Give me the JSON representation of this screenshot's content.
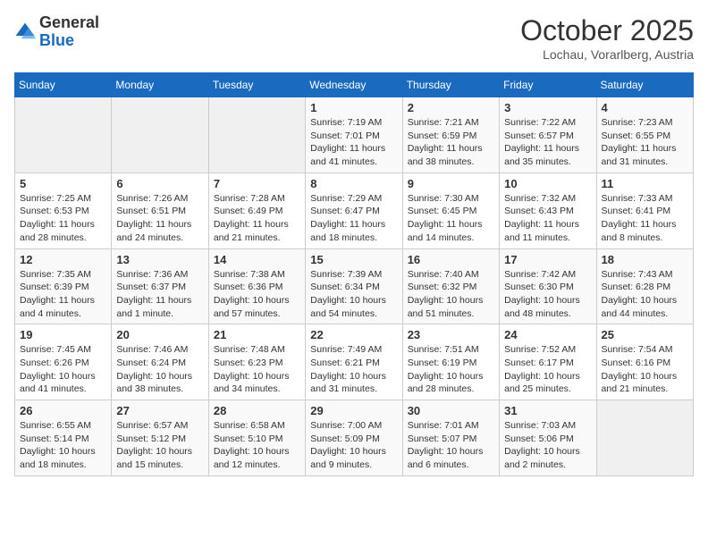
{
  "header": {
    "logo": {
      "general": "General",
      "blue": "Blue"
    },
    "title": "October 2025",
    "location": "Lochau, Vorarlberg, Austria"
  },
  "days_of_week": [
    "Sunday",
    "Monday",
    "Tuesday",
    "Wednesday",
    "Thursday",
    "Friday",
    "Saturday"
  ],
  "weeks": [
    [
      {
        "day": "",
        "info": ""
      },
      {
        "day": "",
        "info": ""
      },
      {
        "day": "",
        "info": ""
      },
      {
        "day": "1",
        "info": "Sunrise: 7:19 AM\nSunset: 7:01 PM\nDaylight: 11 hours and 41 minutes."
      },
      {
        "day": "2",
        "info": "Sunrise: 7:21 AM\nSunset: 6:59 PM\nDaylight: 11 hours and 38 minutes."
      },
      {
        "day": "3",
        "info": "Sunrise: 7:22 AM\nSunset: 6:57 PM\nDaylight: 11 hours and 35 minutes."
      },
      {
        "day": "4",
        "info": "Sunrise: 7:23 AM\nSunset: 6:55 PM\nDaylight: 11 hours and 31 minutes."
      }
    ],
    [
      {
        "day": "5",
        "info": "Sunrise: 7:25 AM\nSunset: 6:53 PM\nDaylight: 11 hours and 28 minutes."
      },
      {
        "day": "6",
        "info": "Sunrise: 7:26 AM\nSunset: 6:51 PM\nDaylight: 11 hours and 24 minutes."
      },
      {
        "day": "7",
        "info": "Sunrise: 7:28 AM\nSunset: 6:49 PM\nDaylight: 11 hours and 21 minutes."
      },
      {
        "day": "8",
        "info": "Sunrise: 7:29 AM\nSunset: 6:47 PM\nDaylight: 11 hours and 18 minutes."
      },
      {
        "day": "9",
        "info": "Sunrise: 7:30 AM\nSunset: 6:45 PM\nDaylight: 11 hours and 14 minutes."
      },
      {
        "day": "10",
        "info": "Sunrise: 7:32 AM\nSunset: 6:43 PM\nDaylight: 11 hours and 11 minutes."
      },
      {
        "day": "11",
        "info": "Sunrise: 7:33 AM\nSunset: 6:41 PM\nDaylight: 11 hours and 8 minutes."
      }
    ],
    [
      {
        "day": "12",
        "info": "Sunrise: 7:35 AM\nSunset: 6:39 PM\nDaylight: 11 hours and 4 minutes."
      },
      {
        "day": "13",
        "info": "Sunrise: 7:36 AM\nSunset: 6:37 PM\nDaylight: 11 hours and 1 minute."
      },
      {
        "day": "14",
        "info": "Sunrise: 7:38 AM\nSunset: 6:36 PM\nDaylight: 10 hours and 57 minutes."
      },
      {
        "day": "15",
        "info": "Sunrise: 7:39 AM\nSunset: 6:34 PM\nDaylight: 10 hours and 54 minutes."
      },
      {
        "day": "16",
        "info": "Sunrise: 7:40 AM\nSunset: 6:32 PM\nDaylight: 10 hours and 51 minutes."
      },
      {
        "day": "17",
        "info": "Sunrise: 7:42 AM\nSunset: 6:30 PM\nDaylight: 10 hours and 48 minutes."
      },
      {
        "day": "18",
        "info": "Sunrise: 7:43 AM\nSunset: 6:28 PM\nDaylight: 10 hours and 44 minutes."
      }
    ],
    [
      {
        "day": "19",
        "info": "Sunrise: 7:45 AM\nSunset: 6:26 PM\nDaylight: 10 hours and 41 minutes."
      },
      {
        "day": "20",
        "info": "Sunrise: 7:46 AM\nSunset: 6:24 PM\nDaylight: 10 hours and 38 minutes."
      },
      {
        "day": "21",
        "info": "Sunrise: 7:48 AM\nSunset: 6:23 PM\nDaylight: 10 hours and 34 minutes."
      },
      {
        "day": "22",
        "info": "Sunrise: 7:49 AM\nSunset: 6:21 PM\nDaylight: 10 hours and 31 minutes."
      },
      {
        "day": "23",
        "info": "Sunrise: 7:51 AM\nSunset: 6:19 PM\nDaylight: 10 hours and 28 minutes."
      },
      {
        "day": "24",
        "info": "Sunrise: 7:52 AM\nSunset: 6:17 PM\nDaylight: 10 hours and 25 minutes."
      },
      {
        "day": "25",
        "info": "Sunrise: 7:54 AM\nSunset: 6:16 PM\nDaylight: 10 hours and 21 minutes."
      }
    ],
    [
      {
        "day": "26",
        "info": "Sunrise: 6:55 AM\nSunset: 5:14 PM\nDaylight: 10 hours and 18 minutes."
      },
      {
        "day": "27",
        "info": "Sunrise: 6:57 AM\nSunset: 5:12 PM\nDaylight: 10 hours and 15 minutes."
      },
      {
        "day": "28",
        "info": "Sunrise: 6:58 AM\nSunset: 5:10 PM\nDaylight: 10 hours and 12 minutes."
      },
      {
        "day": "29",
        "info": "Sunrise: 7:00 AM\nSunset: 5:09 PM\nDaylight: 10 hours and 9 minutes."
      },
      {
        "day": "30",
        "info": "Sunrise: 7:01 AM\nSunset: 5:07 PM\nDaylight: 10 hours and 6 minutes."
      },
      {
        "day": "31",
        "info": "Sunrise: 7:03 AM\nSunset: 5:06 PM\nDaylight: 10 hours and 2 minutes."
      },
      {
        "day": "",
        "info": ""
      }
    ]
  ]
}
